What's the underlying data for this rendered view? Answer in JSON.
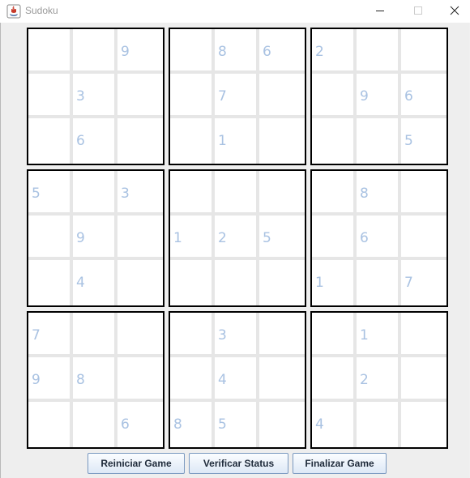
{
  "window": {
    "title": "Sudoku",
    "minimize_glyph": "—",
    "maximize_glyph": "☐",
    "close_glyph": "✕"
  },
  "board": {
    "rows": [
      [
        "",
        "",
        "9",
        "",
        "8",
        "6",
        "2",
        "",
        ""
      ],
      [
        "",
        "3",
        "",
        "",
        "7",
        "",
        "",
        "9",
        "6"
      ],
      [
        "",
        "6",
        "",
        "",
        "1",
        "",
        "",
        "",
        "5"
      ],
      [
        "5",
        "",
        "3",
        "",
        "",
        "",
        "",
        "8",
        ""
      ],
      [
        "",
        "9",
        "",
        "1",
        "2",
        "5",
        "",
        "6",
        ""
      ],
      [
        "",
        "4",
        "",
        "",
        "",
        "",
        "1",
        "",
        "7"
      ],
      [
        "7",
        "",
        "",
        "",
        "3",
        "",
        "",
        "1",
        ""
      ],
      [
        "9",
        "8",
        "",
        "",
        "4",
        "",
        "",
        "2",
        ""
      ],
      [
        "",
        "",
        "6",
        "8",
        "5",
        "",
        "4",
        "",
        ""
      ]
    ]
  },
  "buttons": {
    "restart_label": "Reiniciar Game",
    "check_label": "Verificar Status",
    "finish_label": "Finalizar Game"
  },
  "colors": {
    "clue_text": "#a9c2e2",
    "block_border": "#000000",
    "cell_gap": "#e6e6e6",
    "button_border": "#7a99c0"
  },
  "icons": {
    "app": "java-coffee-cup-icon",
    "minimize": "minimize-icon",
    "maximize": "maximize-icon",
    "close": "close-icon"
  }
}
